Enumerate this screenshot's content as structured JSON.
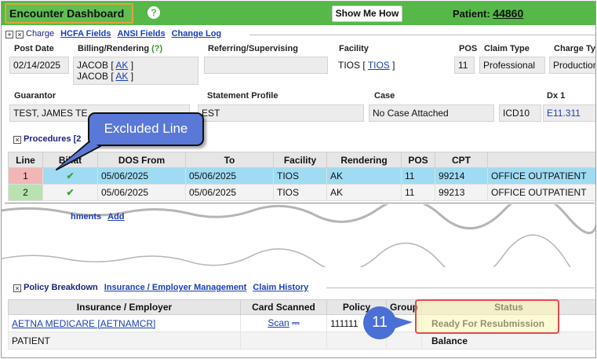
{
  "header": {
    "title": "Encounter Dashboard",
    "help": "?",
    "show_me_how": "Show Me How",
    "patient_label": "Patient:",
    "patient_id": "44860"
  },
  "charge": {
    "toggle_expand": "+",
    "toggle_collapse": "×",
    "label": "Charge",
    "links": [
      "HCFA Fields",
      "ANSI Fields",
      "Change Log"
    ],
    "fields": {
      "post_date": {
        "label": "Post Date",
        "value": "02/14/2025"
      },
      "billing_rendering": {
        "label": "Billing/Rendering",
        "help": "(?)",
        "line1_name": "JACOB",
        "line1_code": "AK",
        "line2_name": "JACOB",
        "line2_code": "AK"
      },
      "referring": {
        "label": "Referring/Supervising",
        "value": ""
      },
      "facility": {
        "label": "Facility",
        "name": "TIOS",
        "code": "TIOS"
      },
      "pos": {
        "label": "POS",
        "value": "11"
      },
      "claim_type": {
        "label": "Claim Type",
        "value": "Professional"
      },
      "charge_type": {
        "label": "Charge Ty",
        "value": "Production"
      },
      "guarantor": {
        "label": "Guarantor",
        "value": "TEST, JAMES TE"
      },
      "statement_profile": {
        "label": "Statement Profile",
        "value": "EST"
      },
      "case": {
        "label": "Case",
        "value": "No Case Attached"
      },
      "icd": {
        "value": "ICD10"
      },
      "dx1": {
        "label": "Dx 1",
        "value": "E11.311"
      }
    }
  },
  "procedures": {
    "toggle": "×",
    "label": "Procedures [2",
    "columns": [
      "Line",
      "Billat",
      "DOS From",
      "To",
      "Facility",
      "Rendering",
      "POS",
      "CPT",
      ""
    ],
    "rows": [
      {
        "line": "1",
        "billable": "✔",
        "dos_from": "05/06/2025",
        "to": "05/06/2025",
        "facility": "TIOS",
        "rendering": "AK",
        "pos": "11",
        "cpt": "99214",
        "desc": "OFFICE OUTPATIENT"
      },
      {
        "line": "2",
        "billable": "✔",
        "dos_from": "05/06/2025",
        "to": "05/06/2025",
        "facility": "TIOS",
        "rendering": "AK",
        "pos": "11",
        "cpt": "99213",
        "desc": "OFFICE OUTPATIENT"
      }
    ],
    "attachments_label": "hments",
    "add_link": "Add"
  },
  "policy": {
    "toggle": "×",
    "label": "Policy Breakdown",
    "links": [
      "Insurance / Employer Management",
      "Claim History"
    ],
    "columns": [
      "Insurance / Employer",
      "Card Scanned",
      "Policy",
      "Group",
      "Status"
    ],
    "rows": [
      {
        "insurance": "AETNA MEDICARE [AETNAMCR]",
        "card": "Scan",
        "policy": "111111",
        "group": "",
        "status": "Ready For Resubmission"
      },
      {
        "insurance": "PATIENT",
        "card": "",
        "policy": "",
        "group": "",
        "status": "Balance"
      }
    ]
  },
  "annotations": {
    "callout_text": "Excluded Line",
    "badge_number": "11"
  },
  "colors": {
    "top_bar": "#55b848",
    "title_outline": "#e0a43a",
    "callout_fill": "#5a78d8",
    "badge_fill": "#4a6fd6",
    "status_outline": "#e34b4b",
    "row_excluded_line": "#f2b6b6",
    "row_selected": "#9fdcf4",
    "link": "#1a3fb5"
  },
  "icons": [
    "help-icon",
    "expand-icon",
    "collapse-icon",
    "check-icon",
    "scanner-icon"
  ]
}
